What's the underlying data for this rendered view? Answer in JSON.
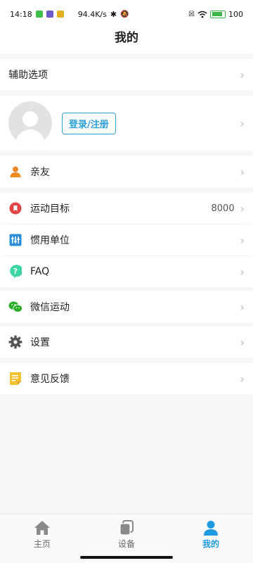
{
  "status_bar": {
    "time": "14:18",
    "net_speed": "94.4K/s",
    "battery": "100"
  },
  "header": {
    "title": "我的"
  },
  "accessibility_row": {
    "label": "辅助选项"
  },
  "profile": {
    "login_label": "登录/注册"
  },
  "menu": {
    "friends": {
      "label": "亲友"
    },
    "goal": {
      "label": "运动目标",
      "value": "8000"
    },
    "units": {
      "label": "惯用单位"
    },
    "faq": {
      "label": "FAQ"
    },
    "wechat": {
      "label": "微信运动"
    },
    "settings": {
      "label": "设置"
    },
    "feedback": {
      "label": "意见反馈"
    }
  },
  "chevron": "›",
  "bottom_nav": {
    "home": "主页",
    "device": "设备",
    "mine": "我的"
  },
  "colors": {
    "accent": "#1e9be0",
    "friends_icon": "#ee8a24",
    "goal_icon": "#e04545",
    "units_icon": "#2a8fd8",
    "faq_icon": "#3cd6a0",
    "wechat_icon": "#2aae2a",
    "settings_icon": "#555555",
    "feedback_icon": "#f2c233"
  },
  "icons": {
    "friends": "person-icon",
    "goal": "target-icon",
    "units": "sliders-icon",
    "faq": "question-icon",
    "wechat": "wechat-icon",
    "settings": "gear-icon",
    "feedback": "note-icon"
  }
}
